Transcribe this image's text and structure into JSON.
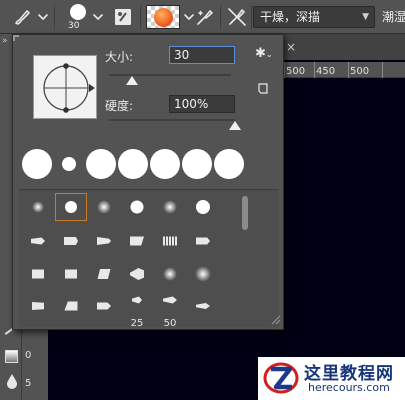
{
  "options_bar": {
    "tool_icon": "brush-icon",
    "brush_size": "30",
    "mode_select": "干燥，深描",
    "trailing_label": "潮湿"
  },
  "brush_panel": {
    "size_label": "大小:",
    "size_value": "30",
    "hardness_label": "硬度:",
    "hardness_value": "100%",
    "size_slider_fraction": 0.19,
    "hardness_slider_fraction": 1.0,
    "preset_numbers": [
      "25",
      "50"
    ]
  },
  "ruler": {
    "horizontal_ticks": [
      "500",
      "450",
      "500"
    ],
    "vertical_ticks": [
      "5",
      "0",
      "5"
    ]
  },
  "watermark": {
    "title": "这里教程网",
    "url": "herecours.com"
  },
  "colors": {
    "panel_bg": "#535353",
    "canvas_bg": "#000014",
    "accent_selected": "#c77a28",
    "field_focus": "#5b8ed6",
    "watermark_text": "#18347c",
    "watermark_logo_red": "#d11f1f",
    "color_swatch_orange": "#f06020"
  }
}
